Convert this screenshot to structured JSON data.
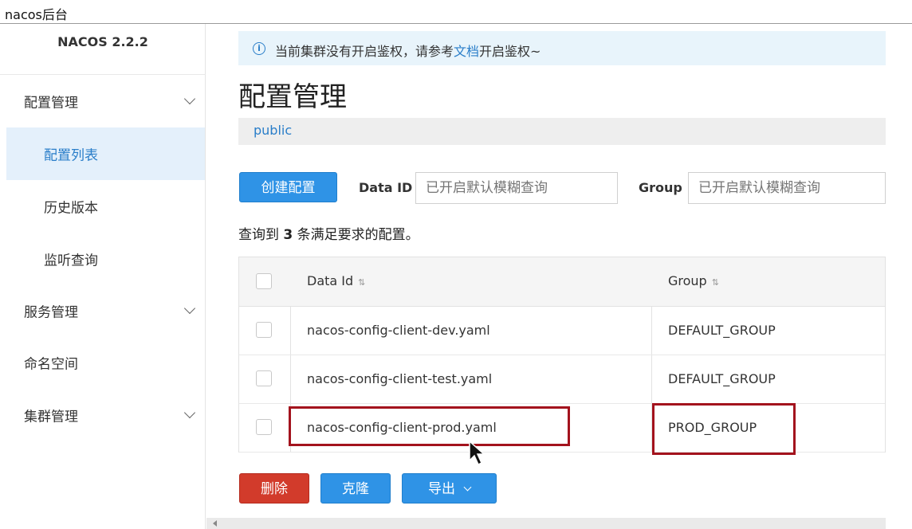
{
  "window": {
    "title": "nacos后台"
  },
  "sidebar": {
    "brand": "NACOS 2.2.2",
    "items": [
      {
        "label": "配置管理",
        "expandable": true
      },
      {
        "label": "配置列表",
        "active": true
      },
      {
        "label": "历史版本"
      },
      {
        "label": "监听查询"
      },
      {
        "label": "服务管理",
        "expandable": true
      },
      {
        "label": "命名空间"
      },
      {
        "label": "集群管理",
        "expandable": true
      }
    ]
  },
  "notice": {
    "prefix": "当前集群没有开启鉴权，请参考",
    "link": "文档",
    "suffix": "开启鉴权~"
  },
  "page": {
    "title": "配置管理",
    "namespace": "public"
  },
  "toolbar": {
    "create_label": "创建配置",
    "data_id_label": "Data ID",
    "data_id_placeholder": "已开启默认模糊查询",
    "group_label": "Group",
    "group_placeholder": "已开启默认模糊查询"
  },
  "result": {
    "prefix": "查询到",
    "count": "3",
    "suffix": "条满足要求的配置。"
  },
  "table": {
    "columns": [
      "Data Id",
      "Group"
    ],
    "rows": [
      {
        "data_id": "nacos-config-client-dev.yaml",
        "group": "DEFAULT_GROUP"
      },
      {
        "data_id": "nacos-config-client-test.yaml",
        "group": "DEFAULT_GROUP"
      },
      {
        "data_id": "nacos-config-client-prod.yaml",
        "group": "PROD_GROUP"
      }
    ]
  },
  "actions": {
    "delete_label": "删除",
    "clone_label": "克隆",
    "export_label": "导出"
  },
  "colors": {
    "accent": "#2a7ec9",
    "primary_button": "#2f93e6",
    "danger_button": "#d23b2b",
    "highlight_box": "#a3131d"
  }
}
